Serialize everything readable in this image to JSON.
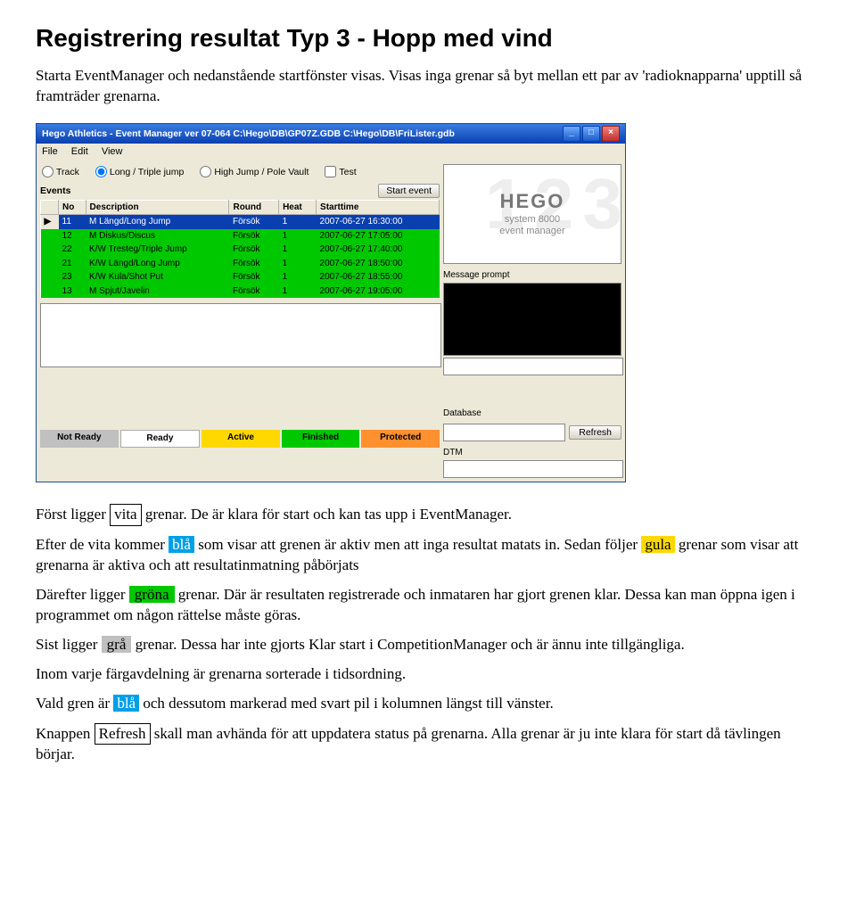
{
  "heading": "Registrering resultat Typ 3 - Hopp med vind",
  "intro": "Starta EventManager och nedanstående startfönster visas. Visas inga grenar så byt mellan ett par av 'radioknapparna' upptill så framträder grenarna.",
  "para2_a": "Först ligger ",
  "para2_vita": "vita",
  "para2_b": " grenar. De är klara för start och kan tas upp i EventManager.",
  "para3_a": "Efter de vita kommer ",
  "para3_bla": "blå",
  "para3_b": " som visar att grenen är aktiv men att inga resultat matats in. Sedan följer ",
  "para3_gula": "gula",
  "para3_c": " grenar som visar att grenarna är aktiva och att resultatinmatning påbörjats",
  "para4_a": "Därefter ligger ",
  "para4_grona": "gröna",
  "para4_b": " grenar. Där är resultaten registrerade och inmataren har gjort grenen klar. Dessa kan man öppna igen i programmet om någon rättelse måste göras.",
  "para5_a": "Sist ligger ",
  "para5_gra": "grå",
  "para5_b": " grenar. Dessa har inte gjorts Klar start i CompetitionManager och är ännu inte tillgängliga.",
  "para6": "Inom varje färgavdelning är grenarna sorterade i tidsordning.",
  "para7_a": "Vald gren är ",
  "para7_bla": "blå",
  "para7_b": " och dessutom markerad med svart pil i kolumnen längst till vänster.",
  "para8_a": "Knappen ",
  "para8_refresh": "Refresh",
  "para8_b": " skall man avhända för att uppdatera status på grenarna. Alla grenar är ju inte klara för start då tävlingen börjar.",
  "app": {
    "title": "Hego Athletics - Event Manager ver 07-064  C:\\Hego\\DB\\GP07Z.GDB C:\\Hego\\DB\\FriLister.gdb",
    "menu": {
      "file": "File",
      "edit": "Edit",
      "view": "View"
    },
    "radios": {
      "track": "Track",
      "ltj": "Long / Triple jump",
      "hjpv": "High Jump / Pole Vault",
      "test": "Test"
    },
    "events_label": "Events",
    "start_event": "Start event",
    "headers": {
      "no": "No",
      "desc": "Description",
      "round": "Round",
      "heat": "Heat",
      "start": "Starttime"
    },
    "rows": [
      {
        "no": "11",
        "desc": "M Längd/Long Jump",
        "round": "Försök",
        "heat": "1",
        "start": "2007-06-27 16:30:00",
        "sel": true
      },
      {
        "no": "12",
        "desc": "M Diskus/Discus",
        "round": "Försök",
        "heat": "1",
        "start": "2007-06-27 17:05:00",
        "sel": false
      },
      {
        "no": "22",
        "desc": "K/W Tresteg/Triple Jump",
        "round": "Försök",
        "heat": "1",
        "start": "2007-06-27 17:40:00",
        "sel": false
      },
      {
        "no": "21",
        "desc": "K/W Längd/Long Jump",
        "round": "Försök",
        "heat": "1",
        "start": "2007-06-27 18:50:00",
        "sel": false
      },
      {
        "no": "23",
        "desc": "K/W Kula/Shot Put",
        "round": "Försök",
        "heat": "1",
        "start": "2007-06-27 18:55:00",
        "sel": false
      },
      {
        "no": "13",
        "desc": "M Spjut/Javelin",
        "round": "Försök",
        "heat": "1",
        "start": "2007-06-27 19:05:00",
        "sel": false
      }
    ],
    "legend": {
      "notready": "Not Ready",
      "ready": "Ready",
      "active": "Active",
      "finished": "Finished",
      "protected": "Protected"
    },
    "side": {
      "hego_big": "HEGO",
      "hego_sub1": "system 8000",
      "hego_sub2": "event manager",
      "msgprompt": "Message prompt",
      "database": "Database",
      "refresh": "Refresh",
      "dtm": "DTM"
    },
    "winbtn": {
      "min": "_",
      "max": "□",
      "close": "×"
    }
  }
}
